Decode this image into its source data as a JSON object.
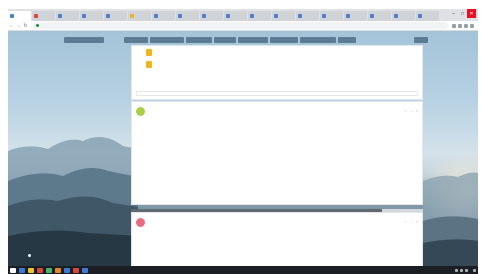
{
  "browser": {
    "tabs": [
      {
        "label": "",
        "favicon_color": "#4a80c8"
      },
      {
        "label": "",
        "favicon_color": "#d9473b"
      },
      {
        "label": "",
        "favicon_color": "#4a80c8"
      },
      {
        "label": "",
        "favicon_color": "#4a80c8"
      },
      {
        "label": "",
        "favicon_color": "#4a80c8"
      },
      {
        "label": "",
        "favicon_color": "#e8b424"
      },
      {
        "label": "",
        "favicon_color": "#4a80c8"
      },
      {
        "label": "",
        "favicon_color": "#4a80c8"
      },
      {
        "label": "",
        "favicon_color": "#4a80c8"
      },
      {
        "label": "",
        "favicon_color": "#4a80c8"
      },
      {
        "label": "",
        "favicon_color": "#4a80c8"
      },
      {
        "label": "",
        "favicon_color": "#4a80c8"
      },
      {
        "label": "",
        "favicon_color": "#4a80c8"
      },
      {
        "label": "",
        "favicon_color": "#4a80c8"
      },
      {
        "label": "",
        "favicon_color": "#4a80c8"
      },
      {
        "label": "",
        "favicon_color": "#4a80c8"
      },
      {
        "label": "",
        "favicon_color": "#4a80c8"
      },
      {
        "label": "",
        "favicon_color": "#4a80c8"
      }
    ],
    "url": "",
    "window_controls": {
      "minimize": "–",
      "maximize": "□",
      "close": "✕"
    }
  },
  "feed_header": {
    "left_pill": "",
    "pills": [
      "",
      "",
      "",
      "",
      "",
      "",
      "",
      ""
    ],
    "right_pill": ""
  },
  "files_card": {
    "files": [
      {
        "name": "",
        "size": ""
      },
      {
        "name": "",
        "size": ""
      }
    ],
    "comment_placeholder": ""
  },
  "post": {
    "author": "",
    "meta": "",
    "lines": [
      "",
      "",
      "",
      ""
    ],
    "footer": "",
    "actions": [
      "",
      "",
      ""
    ]
  },
  "progress": 0.86,
  "post2": {
    "author": "",
    "meta": "",
    "lines": [
      "",
      "",
      "",
      ""
    ]
  },
  "corner_chip": "",
  "taskbar": {
    "clock": ""
  },
  "colors": {
    "accent": "#5d7c94",
    "link": "#2e66b0",
    "file_icon": "#f0b41c",
    "avatar_1": "#a9cf4a",
    "avatar_2": "#e96a83",
    "taskbar": "#1b1f24"
  }
}
